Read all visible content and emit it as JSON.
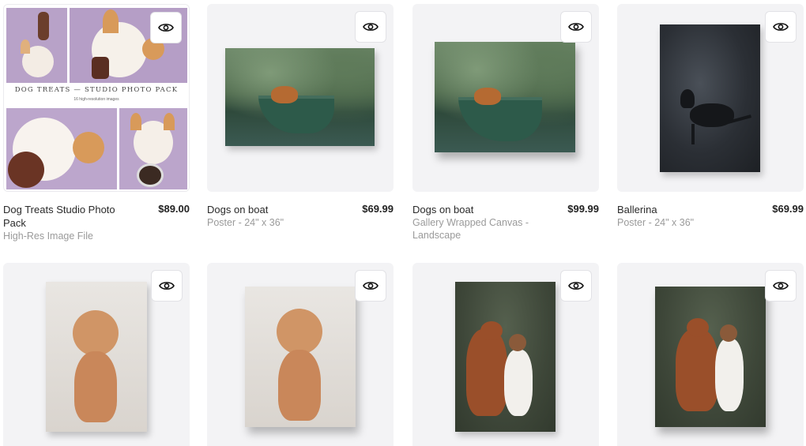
{
  "products": [
    {
      "title": "Dog Treats Studio Photo Pack",
      "subtitle": "High-Res Image File",
      "price": "$89.00",
      "collage_title": "DOG TREATS — STUDIO PHOTO PACK",
      "collage_sub": "16 high-resolution images"
    },
    {
      "title": "Dogs on boat",
      "subtitle": "Poster - 24\" x 36\"",
      "price": "$69.99"
    },
    {
      "title": "Dogs on boat",
      "subtitle": "Gallery Wrapped Canvas - Landscape",
      "price": "$99.99"
    },
    {
      "title": "Ballerina",
      "subtitle": "Poster - 24\" x 36\"",
      "price": "$69.99"
    },
    {
      "title": "",
      "subtitle": "",
      "price": ""
    },
    {
      "title": "",
      "subtitle": "",
      "price": ""
    },
    {
      "title": "",
      "subtitle": "",
      "price": ""
    },
    {
      "title": "",
      "subtitle": "",
      "price": ""
    }
  ],
  "icons": {
    "quick_view": "eye-icon"
  },
  "colors": {
    "background": "#ffffff",
    "card": "#f3f3f5",
    "price": "#222222",
    "subtitle": "#9a9a9a"
  }
}
